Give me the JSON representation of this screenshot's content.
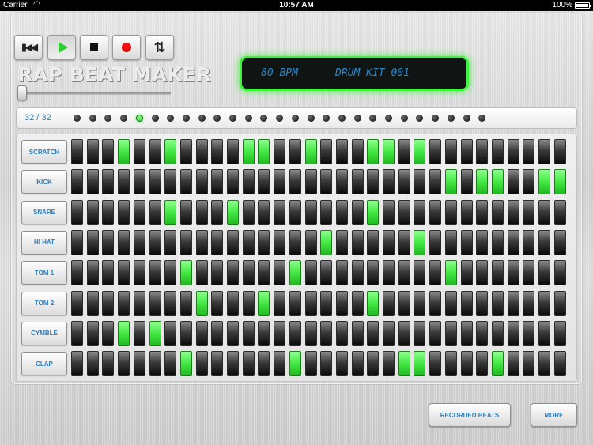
{
  "status_bar": {
    "carrier": "Carrier",
    "time": "10:57 AM",
    "battery": "100%"
  },
  "transport": {
    "buttons": [
      {
        "name": "rewind",
        "icon": "rewind-icon"
      },
      {
        "name": "play",
        "icon": "play-icon",
        "active": true
      },
      {
        "name": "stop",
        "icon": "stop-icon"
      },
      {
        "name": "record",
        "icon": "record-icon"
      },
      {
        "name": "loop",
        "icon": "loop-icon"
      }
    ]
  },
  "title": "RAP BEAT MAKER",
  "tempo_slider": {
    "value_fraction": 0.02
  },
  "display": {
    "bpm": "80 BPM",
    "kit": "DRUM KIT 001"
  },
  "steps": {
    "count_label": "32 / 32",
    "total": 32,
    "current": 5
  },
  "colors": {
    "accent_green": "#42e842",
    "label_blue": "#2a7fc4",
    "lcd_glow": "#3ef23e"
  },
  "tracks": [
    {
      "label": "SCRATCH",
      "on": [
        3,
        6,
        11,
        12,
        15,
        19,
        20,
        22
      ]
    },
    {
      "label": "KICK",
      "on": [
        24,
        26,
        27,
        30,
        31
      ]
    },
    {
      "label": "SNARE",
      "on": [
        6,
        10,
        19
      ]
    },
    {
      "label": "HI HAT",
      "on": [
        16,
        22
      ]
    },
    {
      "label": "TOM 1",
      "on": [
        7,
        14,
        24
      ]
    },
    {
      "label": "TOM 2",
      "on": [
        8,
        12,
        19
      ]
    },
    {
      "label": "CYMBLE",
      "on": [
        3,
        5
      ]
    },
    {
      "label": "CLAP",
      "on": [
        7,
        14,
        21,
        22,
        27
      ]
    }
  ],
  "footer": {
    "recorded_beats": "RECORDED BEATS",
    "more": "MORE"
  }
}
